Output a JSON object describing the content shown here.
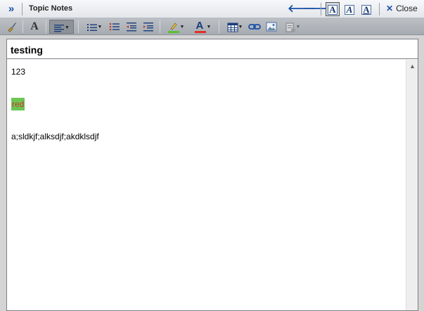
{
  "window": {
    "title": "Topic Notes",
    "close_label": "Close",
    "modes": [
      "A",
      "A",
      "A"
    ]
  },
  "toolbar": {
    "font_glyph": "A",
    "font_color_glyph": "A",
    "highlight_color": "#58c12f",
    "font_color": "#e0302a",
    "accent": "#1a50a8"
  },
  "document": {
    "title": "testing",
    "lines": [
      "123",
      "red",
      "a;sldkjf;alksdjf;akdklsdjf"
    ]
  }
}
